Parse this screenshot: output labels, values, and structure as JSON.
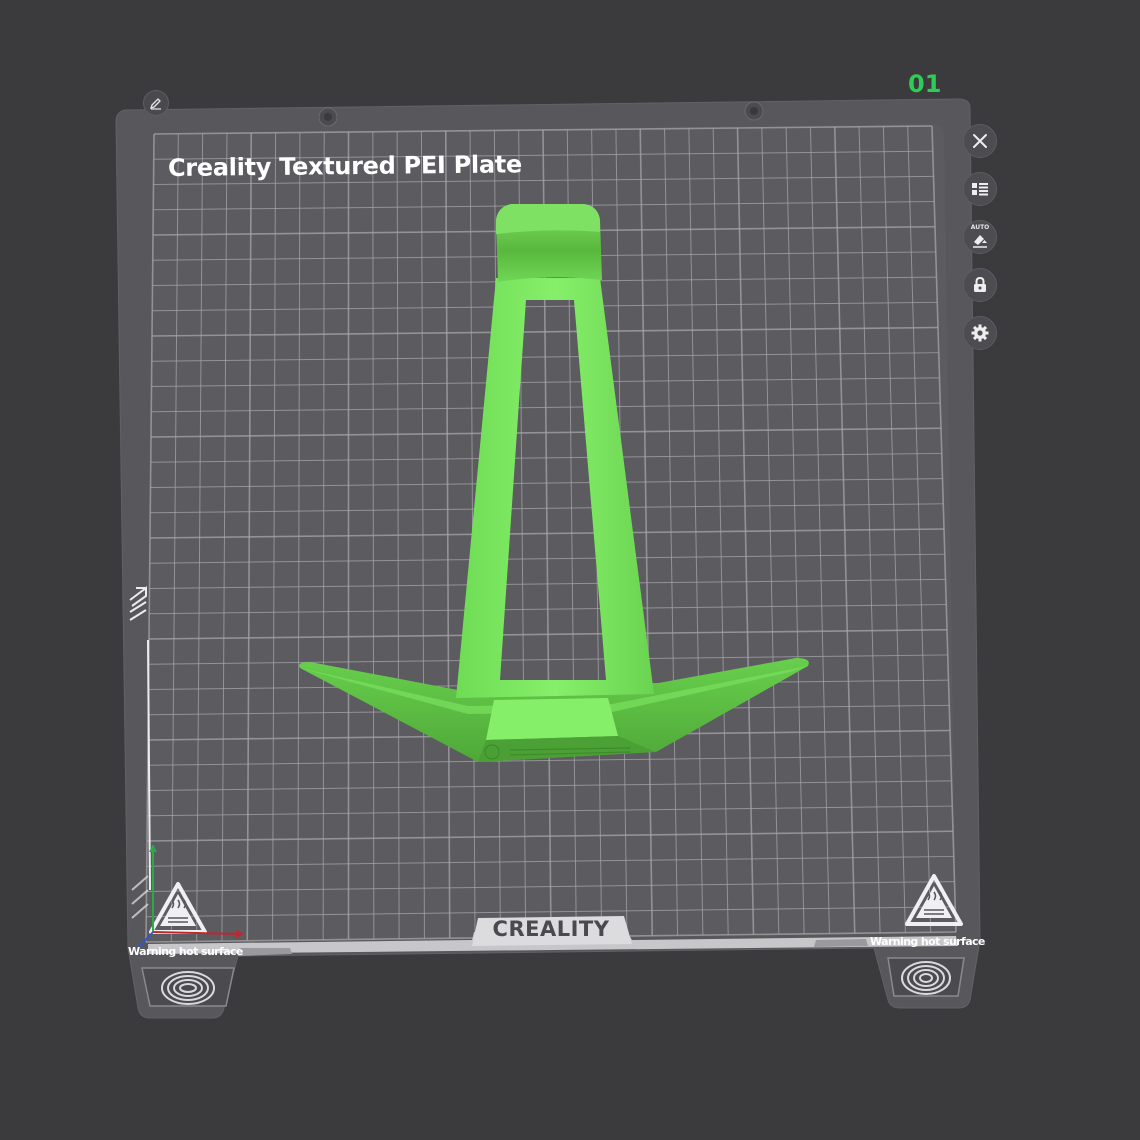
{
  "plate": {
    "title": "Creality Textured PEI Plate",
    "number": "01",
    "brand": "CREALITY",
    "warning_left": "Warning hot surface",
    "warning_right": "Warning hot surface"
  },
  "toolbar": {
    "items": [
      {
        "name": "close",
        "icon": "close-icon"
      },
      {
        "name": "arrange",
        "icon": "list-icon"
      },
      {
        "name": "auto-orient",
        "icon": "auto-orient-icon",
        "tag": "AUTO"
      },
      {
        "name": "lock",
        "icon": "lock-icon"
      },
      {
        "name": "settings",
        "icon": "gear-icon"
      }
    ]
  },
  "colors": {
    "background": "#3b3b3d",
    "plate": "#55555a",
    "grid": "#9a9aa0",
    "model": "#74e65a",
    "model_shade": "#5cc243",
    "plate_number": "#2ecc55"
  }
}
